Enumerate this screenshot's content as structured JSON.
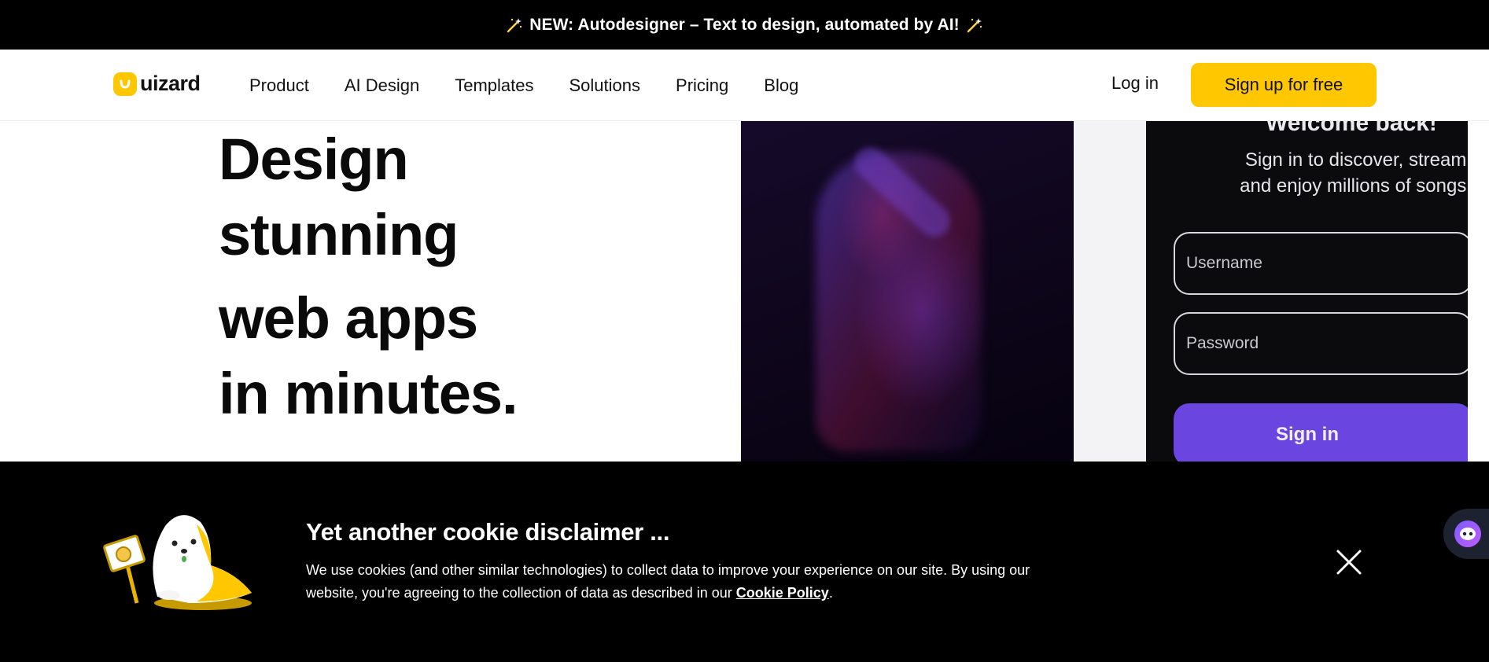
{
  "announcement": {
    "text": "NEW: Autodesigner – Text to design, automated by AI!"
  },
  "brand": {
    "name": "uizard",
    "accent": "#ffc700"
  },
  "nav": {
    "items": [
      "Product",
      "AI Design",
      "Templates",
      "Solutions",
      "Pricing",
      "Blog"
    ],
    "login": "Log in",
    "signup": "Sign up for free"
  },
  "hero": {
    "lines": [
      "Design",
      "stunning",
      "web apps",
      "in minutes."
    ]
  },
  "phone_mockup": {
    "welcome": "Welcome back!",
    "subtitle": "Sign in to discover, stream, and enjoy millions of songs.",
    "username_placeholder": "Username",
    "password_placeholder": "Password",
    "signin_label": "Sign in",
    "accent": "#6a45e0"
  },
  "cookie": {
    "title": "Yet another cookie disclaimer ...",
    "body_prefix": "We use cookies (and other similar technologies) to collect data to improve your experience on our site. By using our website, you're agreeing to the collection of data as described in our ",
    "policy_link": "Cookie Policy",
    "body_suffix": "."
  },
  "icons": {
    "announcement": "magic-wand-icon",
    "close": "close-icon",
    "chat": "chat-assistant-icon"
  }
}
